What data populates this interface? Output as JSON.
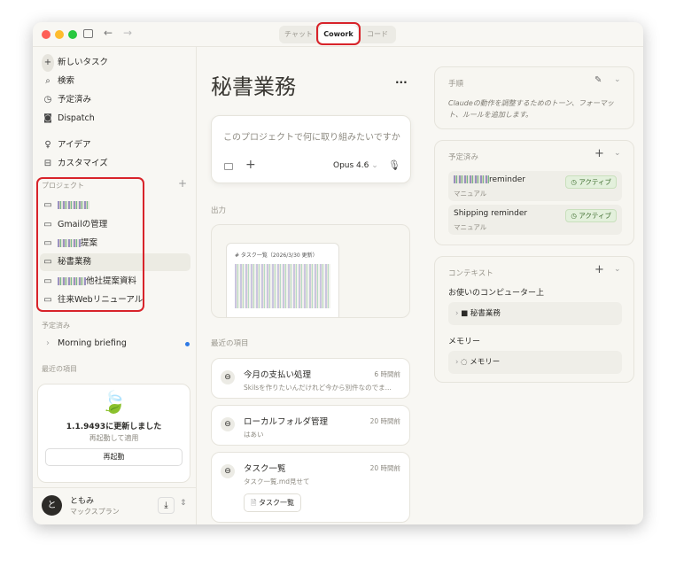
{
  "window": {
    "tabs": [
      {
        "label": "チャット"
      },
      {
        "label": "Cowork",
        "active": true
      },
      {
        "label": "コード"
      }
    ]
  },
  "sidebar": {
    "nav": [
      {
        "label": "新しいタスク",
        "icon": "plus-icon"
      },
      {
        "label": "検索",
        "icon": "search-icon"
      },
      {
        "label": "予定済み",
        "icon": "clock-icon"
      },
      {
        "label": "Dispatch",
        "icon": "dispatch-icon"
      },
      {
        "label": "アイデア",
        "icon": "lightbulb-icon"
      },
      {
        "label": "カスタマイズ",
        "icon": "toolbox-icon"
      }
    ],
    "projects_label": "プロジェクト",
    "projects": [
      {
        "label": "",
        "redacted": true
      },
      {
        "label": "Gmailの管理"
      },
      {
        "label": "提案",
        "redacted": true
      },
      {
        "label": "秘書業務",
        "selected": true
      },
      {
        "label": "他社提案資料",
        "redacted": true
      },
      {
        "label": "往来Webリニューアル"
      }
    ],
    "scheduled_label": "予定済み",
    "scheduled": [
      {
        "label": "Morning briefing",
        "unread": true
      }
    ],
    "recent_label": "最近の項目",
    "update": {
      "title": "1.1.9493に更新しました",
      "subtitle": "再起動して適用",
      "button": "再起動"
    },
    "user": {
      "initial": "と",
      "name": "ともみ",
      "plan": "マックスプラン"
    }
  },
  "main": {
    "title": "秘書業務",
    "more": "...",
    "prompt": {
      "placeholder": "このプロジェクトで何に取り組みたいですか",
      "model": "Opus 4.6"
    },
    "output_label": "出力",
    "output_doc": {
      "heading": "# タスク一覧（2026/3/30 更新）"
    },
    "recent_label": "最近の項目",
    "recent": [
      {
        "title": "今月の支払い処理",
        "time": "6 時間前",
        "snippet": "Skilsを作りたいんだけれど今から別件なのでま..."
      },
      {
        "title": "ローカルフォルダ管理",
        "time": "20 時間前",
        "snippet": "はあい"
      },
      {
        "title": "タスク一覧",
        "time": "20 時間前",
        "snippet": "タスク一覧.md見せて",
        "attachment": "タスク一覧"
      }
    ]
  },
  "right": {
    "instructions": {
      "title": "手順",
      "text": "Claudeの動作を調整するためのトーン、フォーマット、ルールを追加します。"
    },
    "scheduled": {
      "title": "予定済み",
      "items": [
        {
          "name": "reminder",
          "redacted_prefix": true,
          "type": "マニュアル",
          "status": "アクティブ"
        },
        {
          "name": "Shipping reminder",
          "type": "マニュアル",
          "status": "アクティブ"
        }
      ]
    },
    "context": {
      "title": "コンテキスト",
      "computer_label": "お使いのコンピューター上",
      "folder": "秘書業務",
      "memory_label": "メモリー",
      "memory": "メモリー"
    }
  },
  "colors": {
    "accent_red": "#d8232a",
    "active_green": "#3a6a2a",
    "unread_blue": "#2f7ae5"
  }
}
